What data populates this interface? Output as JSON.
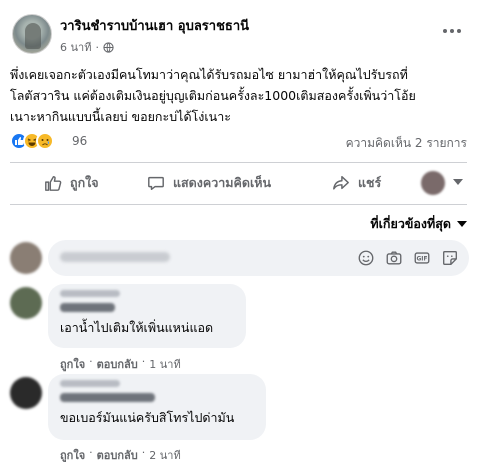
{
  "post": {
    "page_name": "วารินชำราบบ้านเฮา อุบลราชธานี",
    "time": "6 นาที",
    "text_lines": [
      "พึ่งเคยเจอกะตัวเองมีคนโทมาว่าคุณได้รับรถมอไซ ยามาฮ่าให้คุณไปรับรถที่",
      "โลตัสวาริน แค่ต้องเติมเงินอยู่บุญเติมก่อนครั้งละ1000เติมสองครั้งเพิ่นว่าโอ้ย",
      "เนาะหากินแบบนี้เลยบ่ ขอยกะบ่ได้โง่เนาะ"
    ],
    "reaction_count": "96",
    "comment_count": "ความคิดเห็น 2 รายการ"
  },
  "actions": {
    "like": "ถูกใจ",
    "comment": "แสดงความคิดเห็น",
    "share": "แชร์"
  },
  "sort_label": "ที่เกี่ยวข้องที่สุด",
  "comments": [
    {
      "text": "เอาน้ำไปเติมให้เพิ่นแหน่แอด",
      "like": "ถูกใจ",
      "reply": "ตอบกลับ",
      "time": "1 นาที"
    },
    {
      "text": "ขอเบอร์มันแน่ครับสิโทรไปด่ามัน",
      "like": "ถูกใจ",
      "reply": "ตอบกลับ",
      "time": "2 นาที"
    }
  ],
  "colors": {
    "secondary_text": "#65676b",
    "like_blue": "#1877f2",
    "bubble_bg": "#f0f2f5"
  }
}
